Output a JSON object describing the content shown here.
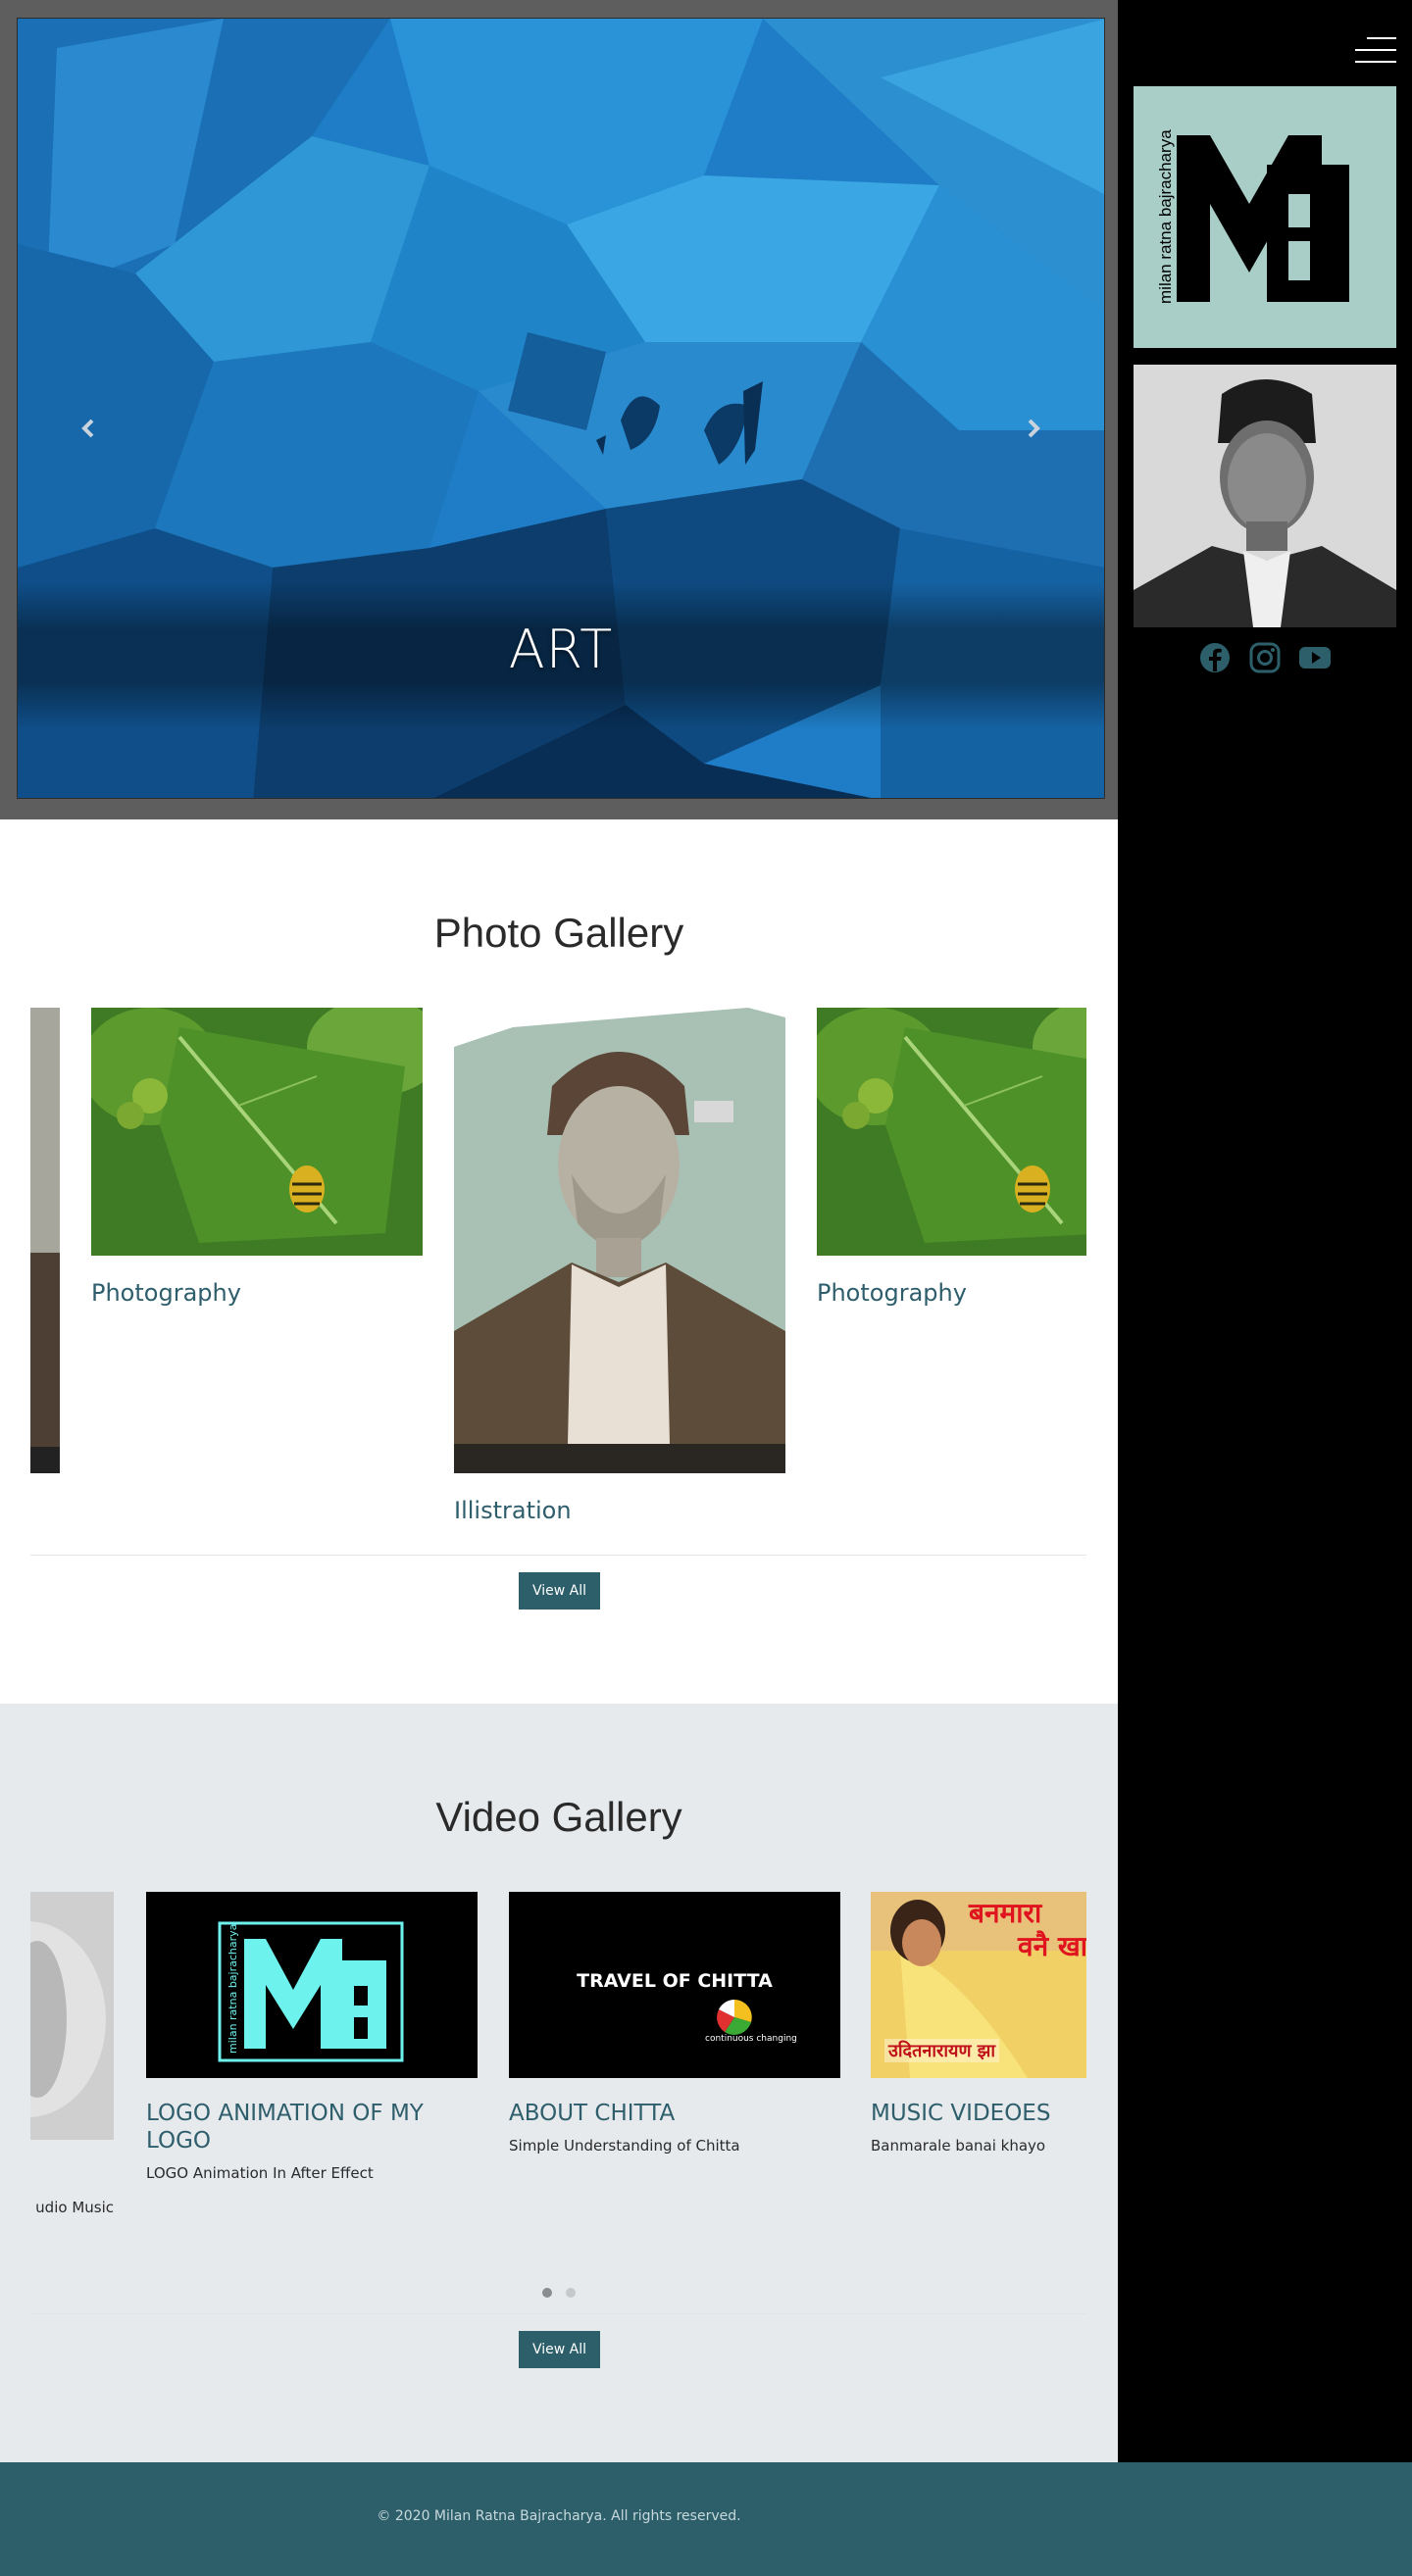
{
  "hero": {
    "caption": "ART",
    "prev_label": "Previous",
    "next_label": "Next"
  },
  "photo_gallery": {
    "title": "Photo Gallery",
    "items": [
      {
        "caption": "Photography"
      },
      {
        "caption": "Illistration"
      },
      {
        "caption": "Photography"
      }
    ],
    "view_all": "View All"
  },
  "video_gallery": {
    "title": "Video Gallery",
    "items": [
      {
        "title": "LOGO ANIMATION OF MY LOGO",
        "desc": "LOGO Animation In After Effect"
      },
      {
        "title": "ABOUT CHITTA",
        "desc": "Simple Understanding of Chitta",
        "thumb_title": "TRAVEL OF  CHITTA",
        "thumb_sub": "continuous changing"
      },
      {
        "title": "MUSIC VIDEOES",
        "desc": "Banmarale banai khayo",
        "thumb_text_1": "बनमारा",
        "thumb_text_2": "वनै खा",
        "thumb_text_3": "उदितनारायण झा"
      }
    ],
    "partial_desc": "udio Music",
    "dots": 2,
    "active_dot": 0,
    "view_all": "View All"
  },
  "sidebar": {
    "logo_text": "milan ratna bajracharya",
    "logo_letters": "MrB",
    "social": [
      "facebook-icon",
      "instagram-icon",
      "youtube-icon"
    ]
  },
  "footer": {
    "text": "© 2020 Milan Ratna Bajracharya. All rights reserved."
  },
  "colors": {
    "accent": "#2c5f6a",
    "link": "#2e5e6c",
    "logo_bg": "#a9cec7",
    "video_bg": "#e7eaed"
  }
}
